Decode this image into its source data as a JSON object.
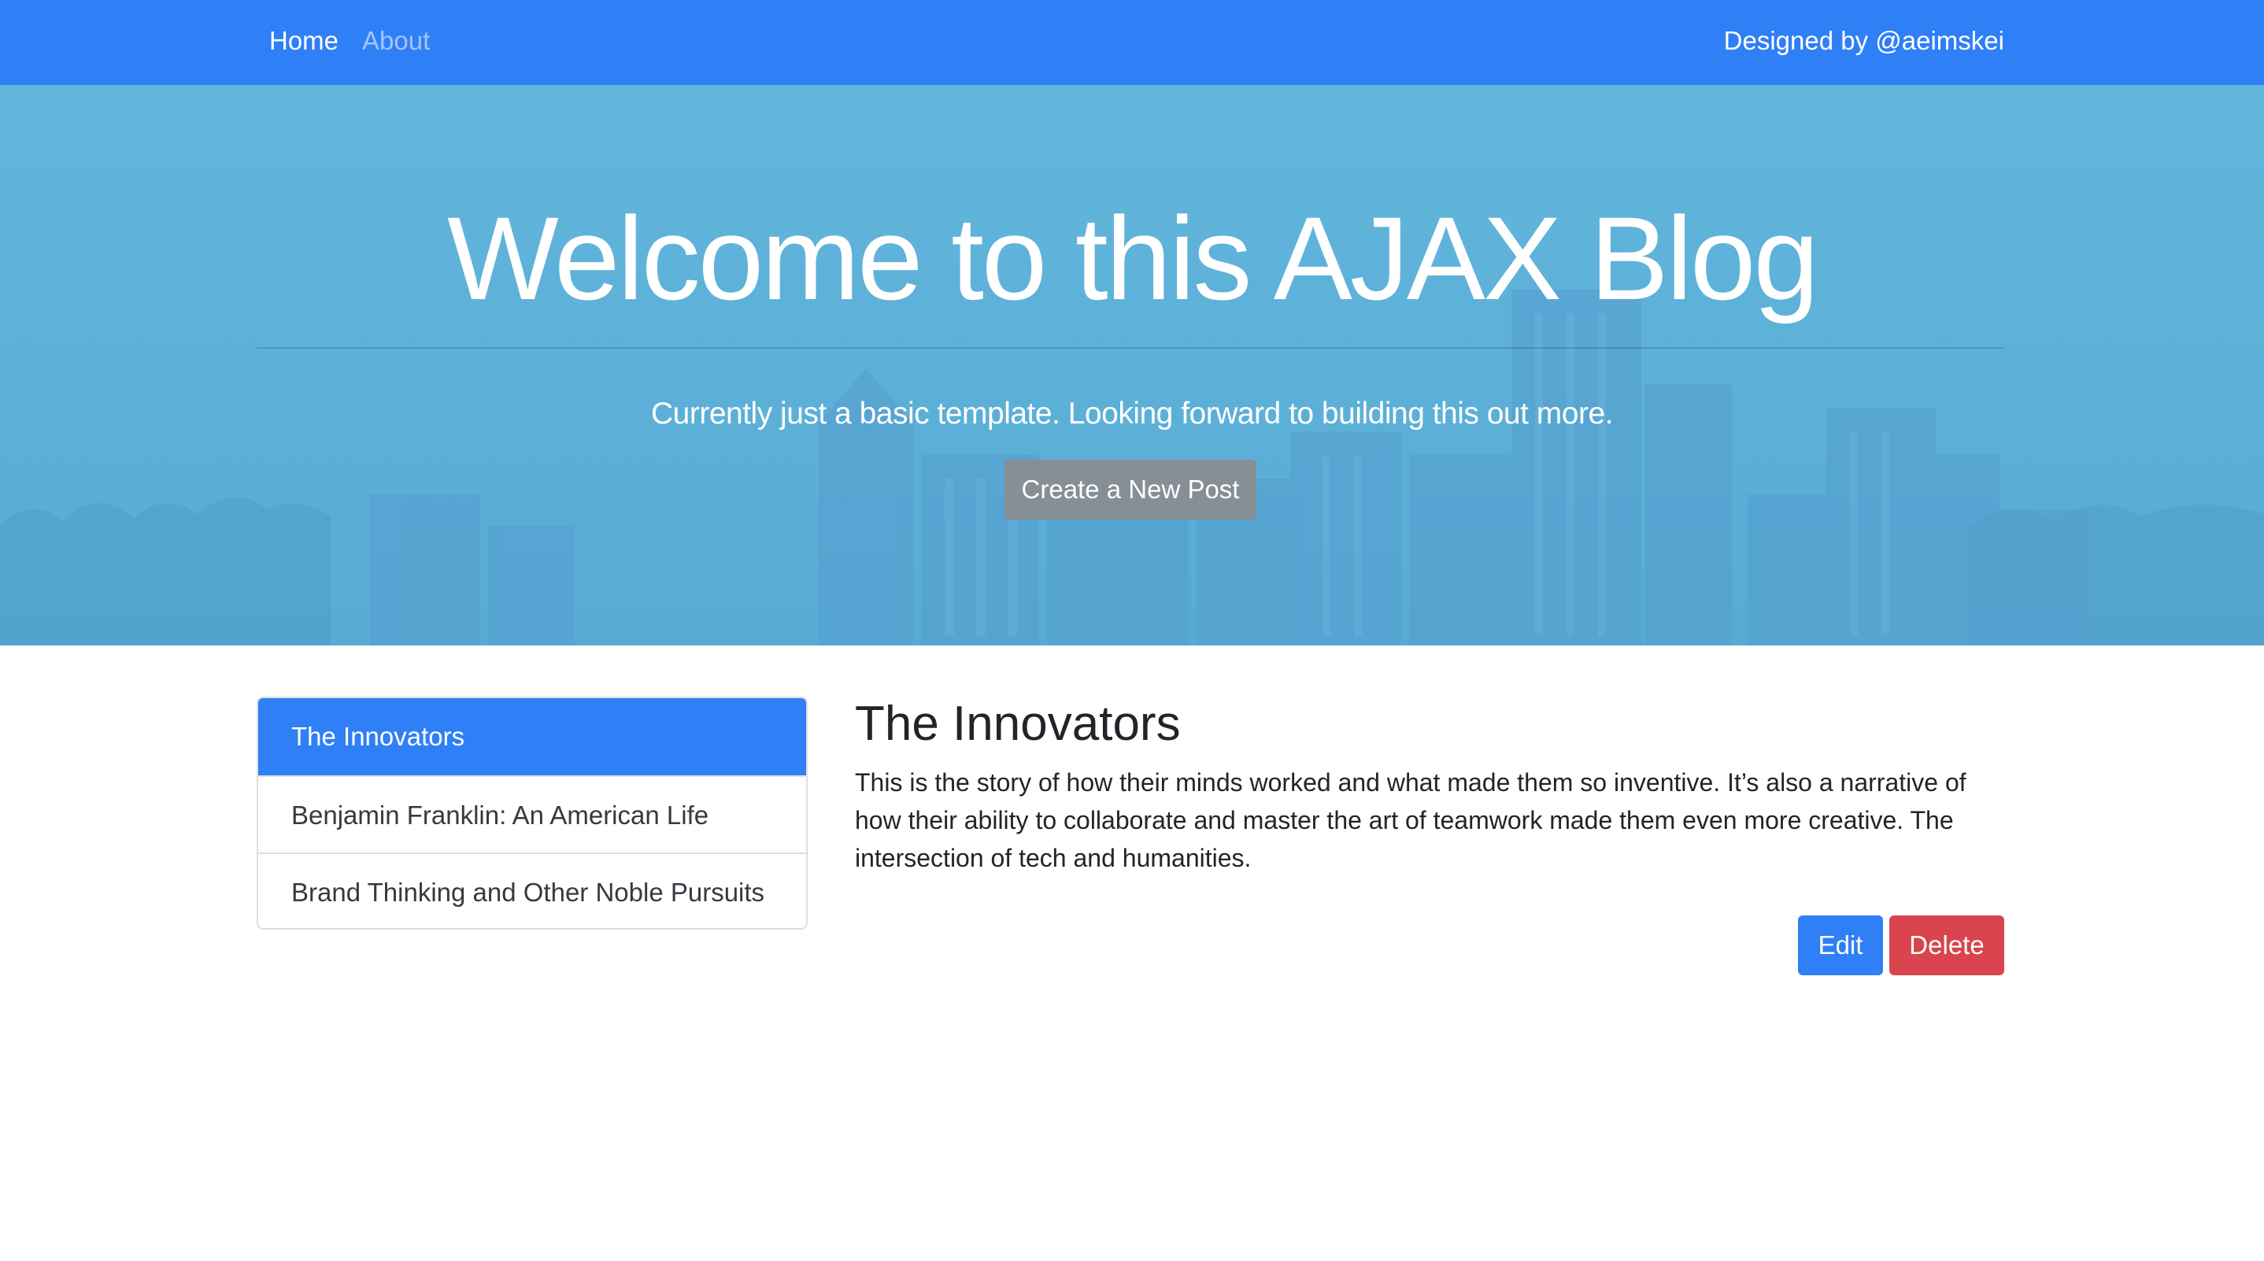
{
  "navbar": {
    "links": [
      {
        "label": "Home",
        "active": true
      },
      {
        "label": "About",
        "active": false
      }
    ],
    "credit": "Designed by @aeimskei",
    "color": "#2f7ff6"
  },
  "hero": {
    "title": "Welcome to this AJAX Blog",
    "lead": "Currently just a basic template. Looking forward to building this out more.",
    "create_button": "Create a New Post",
    "background_color": "#5fb3da"
  },
  "post_list": {
    "items": [
      {
        "label": "The Innovators",
        "active": true
      },
      {
        "label": "Benjamin Franklin: An American Life",
        "active": false
      },
      {
        "label": "Brand Thinking and Other Noble Pursuits",
        "active": false
      }
    ]
  },
  "post": {
    "title": "The Innovators",
    "body": "This is the story of how their minds worked and what made them so inventive. It’s also a narrative of how their ability to collaborate and master the art of teamwork made them even more creative. The intersection of tech and humanities.",
    "edit_label": "Edit",
    "delete_label": "Delete"
  },
  "colors": {
    "primary": "#2f7ff6",
    "secondary": "#868e96",
    "danger": "#d9444f"
  }
}
